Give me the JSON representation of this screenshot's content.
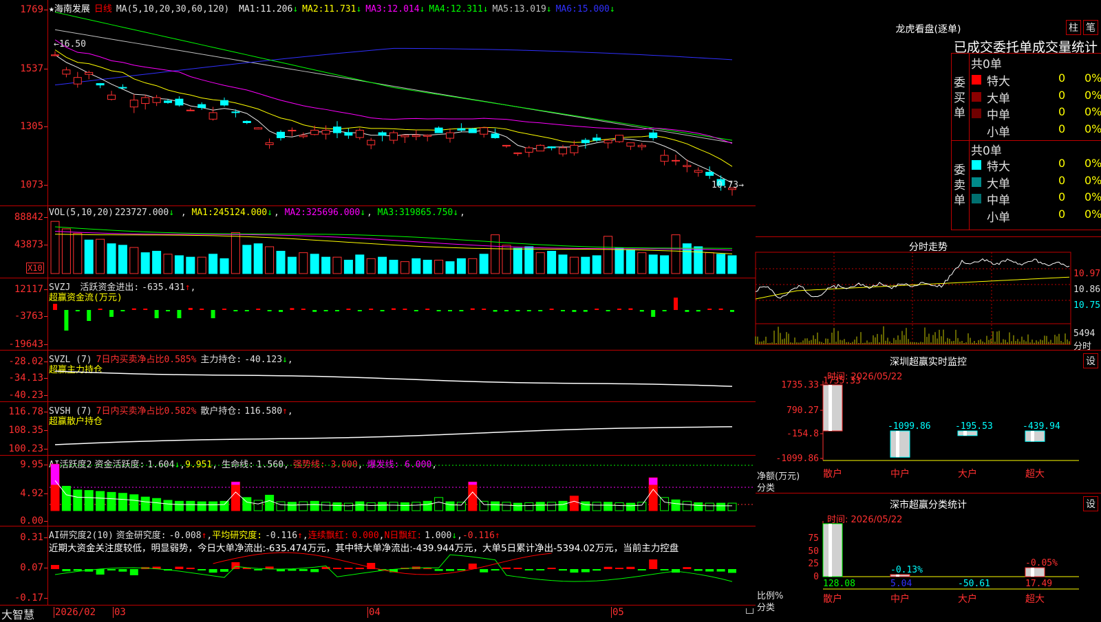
{
  "stock": {
    "name": "海南发展",
    "period": "日线",
    "star": "★"
  },
  "main": {
    "ma_label": "MA(5,10,20,30,60,120)",
    "ma": [
      {
        "label": "MA1:",
        "value": "11.206",
        "dir": "↓",
        "color": "#e8e8e8"
      },
      {
        "label": "MA2:",
        "value": "11.731",
        "dir": "↓",
        "color": "#ffff00"
      },
      {
        "label": "MA3:",
        "value": "12.014",
        "dir": "↓",
        "color": "#ff00ff"
      },
      {
        "label": "MA4:",
        "value": "12.311",
        "dir": "↓",
        "color": "#00ff00"
      },
      {
        "label": "MA5:",
        "value": "13.019",
        "dir": "↓",
        "color": "#c0c0c0"
      },
      {
        "label": "MA6:",
        "value": "15.000",
        "dir": "↓",
        "color": "#3030ff"
      }
    ],
    "yticks": [
      "1769",
      "1537",
      "1305",
      "1073"
    ],
    "high_label": "←16.50",
    "low_label": "10.73→"
  },
  "vol": {
    "header": "VOL(5,10,20)",
    "value": "223727.000",
    "dir": "↓",
    "ma": [
      {
        "label": "MA1:",
        "value": "245124.000",
        "dir": "↓",
        "color": "#ffff00"
      },
      {
        "label": "MA2:",
        "value": "325696.000",
        "dir": "↓",
        "color": "#ff00ff"
      },
      {
        "label": "MA3:",
        "value": "319865.750",
        "dir": "↓",
        "color": "#00ff00"
      }
    ],
    "yticks": [
      "88842",
      "43873"
    ],
    "unit": "X10"
  },
  "svzj": {
    "name": "SVZJ",
    "label": "活跃资金进出:",
    "value": "-635.431",
    "dir": "↑",
    "sub": "超赢资金流(万元)",
    "yticks": [
      "12117",
      "-3763",
      "-19643"
    ]
  },
  "svzl": {
    "name": "SVZL (7)",
    "label1": "7日内买卖净占比0.585%",
    "label2": "主力持仓:",
    "value": "-40.123",
    "dir": "↓",
    "sub": "超赢主力持仓",
    "yticks": [
      "-28.02",
      "-34.13",
      "-40.23"
    ]
  },
  "svsh": {
    "name": "SVSH (7)",
    "label1": "7日内买卖净占比0.582%",
    "label2": "散户持仓:",
    "value": "116.580",
    "dir": "↑",
    "sub": "超赢散户持仓",
    "yticks": [
      "116.78",
      "108.35",
      "100.23"
    ]
  },
  "ai1": {
    "name": "AI活跃度2",
    "label": "资金活跃度:",
    "value": "1.604",
    "dir": "↓",
    "v2": "9.951",
    "label3": "生命线:",
    "v3": "1.560",
    "strong": "强势线: 3.000",
    "burst": "爆发线: 6.000",
    "yticks": [
      "9.95",
      "4.92",
      "0.00"
    ]
  },
  "ai2": {
    "name": "AI研究度2(10)",
    "label": "资金研究度:",
    "value": "-0.008",
    "dir": "↑",
    "label2": "平均研究度:",
    "v2": "-0.116",
    "dir2": "↑",
    "label3": "连续飘红:",
    "v3": "0.000",
    "label4": "N日飘红:",
    "v4": "1.000",
    "dir4": "↓",
    "v5": "-0.116",
    "dir5": "↑",
    "note": "近期大资金关注度较低，明显弱势，今日大单净流出:-635.474万元，其中特大单净流出:-439.944万元，大单5日累计净出-5394.02万元，当前主力控盘",
    "yticks": [
      "0.31",
      "0.07",
      "-0.17"
    ]
  },
  "xaxis": {
    "labels": [
      "2026/02",
      "03",
      "04",
      "05"
    ],
    "brand": "大智慧"
  },
  "longhu": {
    "title": "龙虎看盘(逐单)",
    "btn1": "柱",
    "btn2": "笔",
    "heading": "已成交委托单成交量统计",
    "buy": {
      "side": "委买单",
      "total": "共0单",
      "rows": [
        {
          "name": "特大",
          "count": "0",
          "pct": "0%",
          "color": "#ff0000"
        },
        {
          "name": "大单",
          "count": "0",
          "pct": "0%",
          "color": "#8b0000"
        },
        {
          "name": "中单",
          "count": "0",
          "pct": "0%",
          "color": "#700000"
        },
        {
          "name": "小单",
          "count": "0",
          "pct": "0%",
          "color": "#000000"
        }
      ]
    },
    "sell": {
      "side": "委卖单",
      "total": "共0单",
      "rows": [
        {
          "name": "特大",
          "count": "0",
          "pct": "0%",
          "color": "#00ffff"
        },
        {
          "name": "大单",
          "count": "0",
          "pct": "0%",
          "color": "#008b8b"
        },
        {
          "name": "中单",
          "count": "0",
          "pct": "0%",
          "color": "#007070"
        },
        {
          "name": "小单",
          "count": "0",
          "pct": "0%",
          "color": "#000000"
        }
      ]
    }
  },
  "intraday": {
    "title": "分时走势",
    "prices": [
      "10.97",
      "10.86",
      "10.75"
    ],
    "vol": "5494",
    "vol_unit": "分时"
  },
  "monitor": {
    "title": "深圳超赢实时监控",
    "btn": "设",
    "time": "时间: 2026/05/22",
    "yticks": [
      "1735.33",
      "790.27",
      "-154.8",
      "-1099.86"
    ],
    "ylabel": "净额(万元)",
    "xlabel": "分类",
    "cats": [
      "散户",
      "中户",
      "大户",
      "超大"
    ],
    "values": [
      "1735.33",
      "-1099.86",
      "-195.53",
      "-439.94"
    ]
  },
  "classify": {
    "title": "深市超赢分类统计",
    "btn": "设",
    "time": "时间: 2026/05/22",
    "yticks": [
      "75",
      "50",
      "25",
      "0"
    ],
    "ylabel": "比例%",
    "xlabel": "分类",
    "cats": [
      "散户",
      "中户",
      "大户",
      "超大"
    ],
    "top": [
      "",
      "-0.13%",
      "",
      "-0.05%"
    ],
    "values": [
      "128.08",
      "5.04",
      "-50.61",
      "17.49"
    ]
  }
}
